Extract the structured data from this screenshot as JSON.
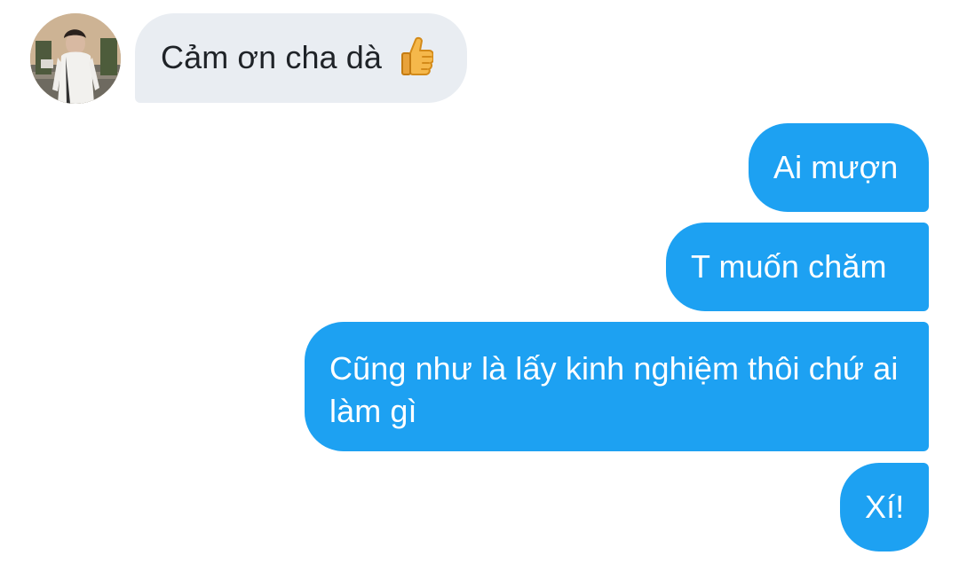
{
  "chat": {
    "incoming": {
      "text": "Cảm ơn cha dà",
      "emoji": "thumbs-up-icon"
    },
    "outgoing": [
      {
        "text": "Ai mượn"
      },
      {
        "text": "T muốn chăm"
      },
      {
        "text": "Cũng như là lấy kinh nghiệm thôi chứ ai làm gì"
      },
      {
        "text": "Xí!"
      }
    ]
  },
  "colors": {
    "incoming_bubble": "#e9edf2",
    "outgoing_bubble": "#1da1f2",
    "incoming_text": "#1f2328",
    "outgoing_text": "#ffffff"
  }
}
